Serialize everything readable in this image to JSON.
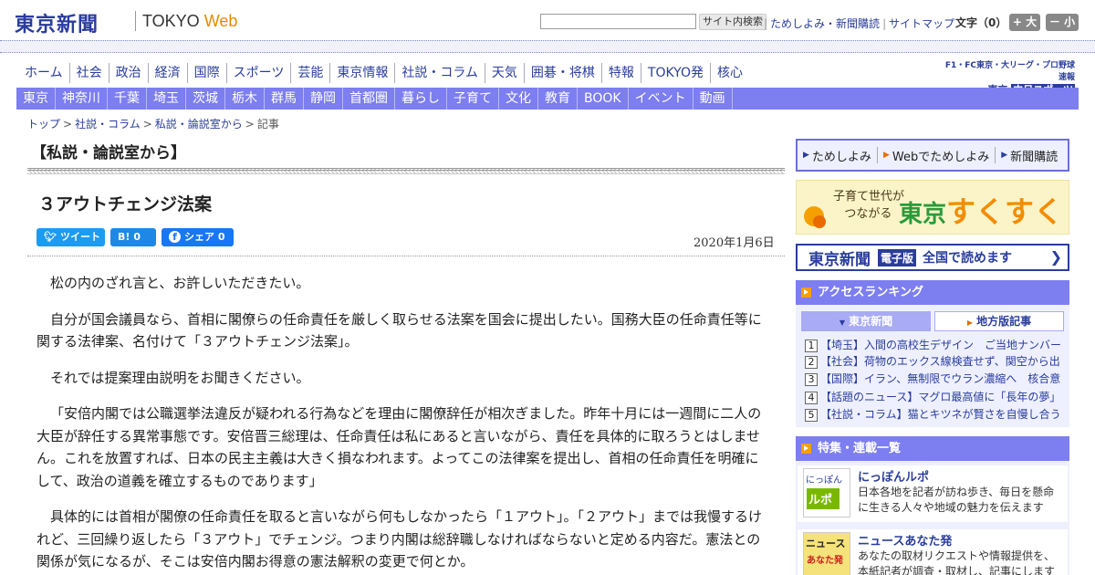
{
  "header": {
    "logo_jp": "東京新聞",
    "logo_en_a": "TOKYO ",
    "logo_en_b": "Web",
    "search_button": "サイト内検索",
    "util_links": [
      "ためしよみ・新聞購読",
      "サイトマップ"
    ],
    "font_size_label": "文字（0）",
    "font_plus": "+ 大",
    "font_minus": "－ 小"
  },
  "nav_main": [
    "ホーム",
    "社会",
    "政治",
    "経済",
    "国際",
    "スポーツ",
    "芸能",
    "東京情報",
    "社説・コラム",
    "天気",
    "囲碁・将棋",
    "特報",
    "TOKYO発",
    "核心"
  ],
  "chunichi": {
    "line1": "F1・FC東京・大リーグ・プロ野球速報",
    "line2_a": "東京",
    "line2_b": "中日スポーツ"
  },
  "nav_sub": [
    "東京",
    "神奈川",
    "千葉",
    "埼玉",
    "茨城",
    "栃木",
    "群馬",
    "静岡",
    "首都圏",
    "暮らし",
    "子育て",
    "文化",
    "教育",
    "BOOK",
    "イベント",
    "動画"
  ],
  "breadcrumb": [
    "トップ",
    "社説・コラム",
    "私説・論説室から",
    "記事"
  ],
  "article": {
    "section": "【私説・論説室から】",
    "title": "３アウトチェンジ法案",
    "date": "2020年1月6日",
    "share": {
      "tweet": "ツイート",
      "hatena_label": "B!",
      "hatena_count": "0",
      "fb_label": "シェア",
      "fb_count": "0"
    },
    "paragraphs": [
      "松の内のざれ言と、お許しいただきたい。",
      "自分が国会議員なら、首相に閣僚らの任命責任を厳しく取らせる法案を国会に提出したい。国務大臣の任命責任等に関する法律案、名付けて「３アウトチェンジ法案」。",
      "それでは提案理由説明をお聞きください。",
      "「安倍内閣では公職選挙法違反が疑われる行為などを理由に閣僚辞任が相次ぎました。昨年十月には一週間に二人の大臣が辞任する異常事態です。安倍晋三総理は、任命責任は私にあると言いながら、責任を具体的に取ろうとはしません。これを放置すれば、日本の民主主義は大きく損なわれます。よってこの法律案を提出し、首相の任命責任を明確にして、政治の道義を確立するものであります」",
      "具体的には首相が閣僚の任命責任を取ると言いながら何もしなかったら「１アウト」。「２アウト」までは我慢するけれど、三回繰り返したら「３アウト」でチェンジ。つまり内閣は総辞職しなければならないと定める内容だ。憲法との関係が気になるが、そこは安倍内閣お得意の憲法解釈の変更で何とか。"
    ]
  },
  "sidebar": {
    "promo": [
      "ためしよみ",
      "Webでためしよみ",
      "新聞購読"
    ],
    "sukusuku": {
      "small_1": "子育て世代が",
      "small_2": "つながる",
      "big_a": "東京",
      "big_b": "すくすく"
    },
    "denshi": {
      "name": "東京新聞",
      "badge": "電子版",
      "text": "全国で読めます"
    },
    "ranking_title": "アクセスランキング",
    "tabs": [
      "東京新聞",
      "地方版記事"
    ],
    "ranking": [
      "【埼玉】入間の高校生デザイン　ご当地ナンバー",
      "【社会】荷物のエックス線検査せず、関空から出国",
      "【国際】イラン、無制限でウラン濃縮へ　核合意",
      "【話題のニュース】マグロ最高値に「長年の夢」",
      "【社説・コラム】猫とキツネが賢さを自慢し合う"
    ],
    "features_title": "特集・連載一覧",
    "features": [
      {
        "title": "にっぽんルポ",
        "desc": "日本各地を記者が訪ね歩き、毎日を懸命に生きる人々や地域の魅力を伝えます",
        "thumb_a": "にっぽん",
        "thumb_b": "ルポ"
      },
      {
        "title": "ニュースあなた発",
        "desc": "あなたの取材リクエストや情報提供を、本紙記者が調査・取材し、記事にします",
        "thumb_a": "ニュース",
        "thumb_b": "あなた発"
      }
    ]
  },
  "colors": {
    "brand": "#2a3d9c",
    "nav_sub_bg": "#7d7ef0",
    "accent": "#e58a00"
  }
}
